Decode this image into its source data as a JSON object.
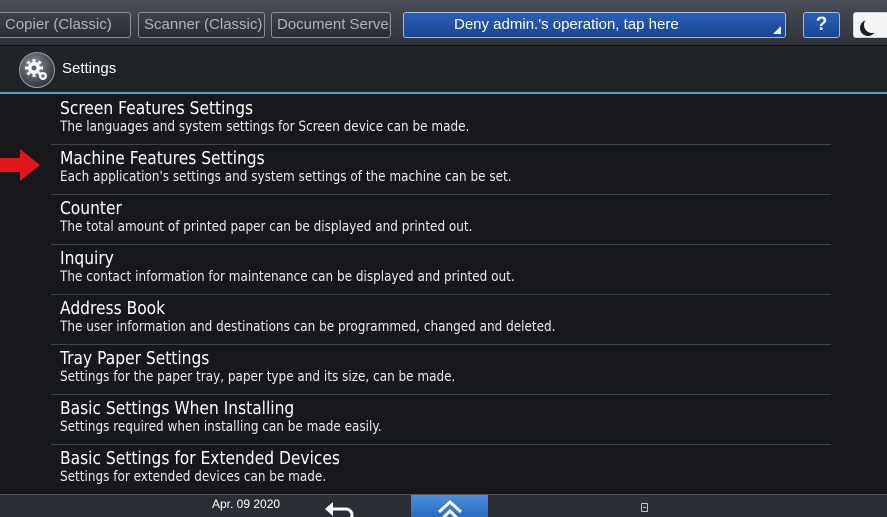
{
  "tabs": [
    "Copier (Classic)",
    "Scanner (Classic)",
    "Document Server"
  ],
  "deny_button": "Deny admin.'s operation, tap here",
  "help_button": "?",
  "title": "Settings",
  "items": [
    {
      "title": "Screen Features Settings",
      "desc": "The languages and system settings for Screen device can be made."
    },
    {
      "title": "Machine Features Settings",
      "desc": "Each application's settings and system settings of the machine can be set."
    },
    {
      "title": "Counter",
      "desc": "The total amount of printed paper can be displayed and printed out."
    },
    {
      "title": "Inquiry",
      "desc": "The contact information for maintenance can be displayed and printed out."
    },
    {
      "title": "Address Book",
      "desc": "The user information and destinations can be programmed, changed and deleted."
    },
    {
      "title": "Tray Paper Settings",
      "desc": "Settings for the paper tray, paper type and its size, can be made."
    },
    {
      "title": "Basic Settings When Installing",
      "desc": "Settings required when installing can be made easily."
    },
    {
      "title": "Basic Settings for Extended Devices",
      "desc": "Settings for extended devices can be made."
    }
  ],
  "status": {
    "date": "Apr. 09 2020"
  },
  "colors": {
    "accent_line": "#4aa8c8",
    "deny_blue": "#1a4591",
    "home_blue": "#2a6bc4",
    "highlight_arrow": "#e3161b"
  },
  "icons": [
    "gear-icon",
    "moon-icon",
    "back-icon",
    "home-icon",
    "storage-icon",
    "arrow-pointer-icon"
  ]
}
